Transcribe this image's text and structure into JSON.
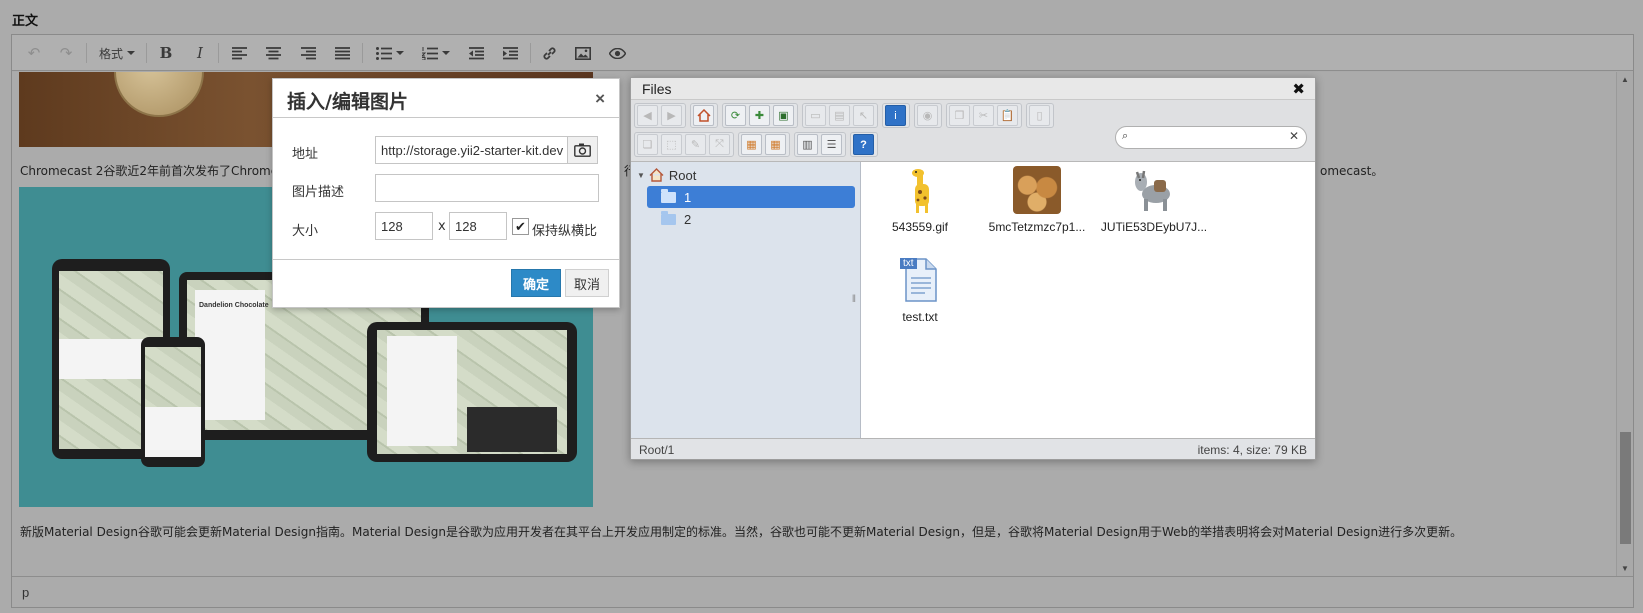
{
  "field_label": "正文",
  "toolbar": {
    "undo_icon": "undo-icon",
    "redo_icon": "redo-icon",
    "format_label": "格式",
    "bold": "B",
    "italic": "I"
  },
  "content": {
    "para1": "Chromecast 2谷歌近2年前首次发布了Chromecast",
    "para1_cut1": "行",
    "para1_cut2": "omecast。",
    "para2": "新版Material Design谷歌可能会更新Material Design指南。Material Design是谷歌为应用开发者在其平台上开发应用制定的标准。当然，谷歌也可能不更新Material Design，但是，谷歌将Material Design用于Web的举措表明将会对Material Design进行多次更新。",
    "card_title": "Dandelion Chocolate"
  },
  "statusbar": {
    "path": "p"
  },
  "dialog": {
    "title": "插入/编辑图片",
    "close": "×",
    "source_label": "地址",
    "source_value": "http://storage.yii2-starter-kit.dev",
    "description_label": "图片描述",
    "description_value": "",
    "size_label": "大小",
    "width": "128",
    "height": "128",
    "size_separator": "x",
    "constrain_label": "保持纵横比",
    "constrain_checked": true,
    "ok": "确定",
    "cancel": "取消"
  },
  "file_manager": {
    "title": "Files",
    "close": "✖",
    "search_value": "",
    "tree": [
      {
        "label": "Root"
      },
      {
        "label": "1",
        "selected": true
      },
      {
        "label": "2"
      }
    ],
    "files": [
      {
        "name": "543559.gif",
        "icon": "giraffe-thumbnail"
      },
      {
        "name": "5mcTetzmzc7p1...",
        "icon": "cookies-thumbnail"
      },
      {
        "name": "JUTiE53DEybU7J...",
        "icon": "donkey-thumbnail"
      },
      {
        "name": "test.txt",
        "icon": "text-file-icon",
        "badge": "txt"
      }
    ],
    "status_path": "Root/1",
    "status_info": "items: 4, size: 79 KB"
  },
  "colors": {
    "accent": "#2d8ac7",
    "tree_selected": "#3d7ed6",
    "overlay": "#ababab"
  }
}
